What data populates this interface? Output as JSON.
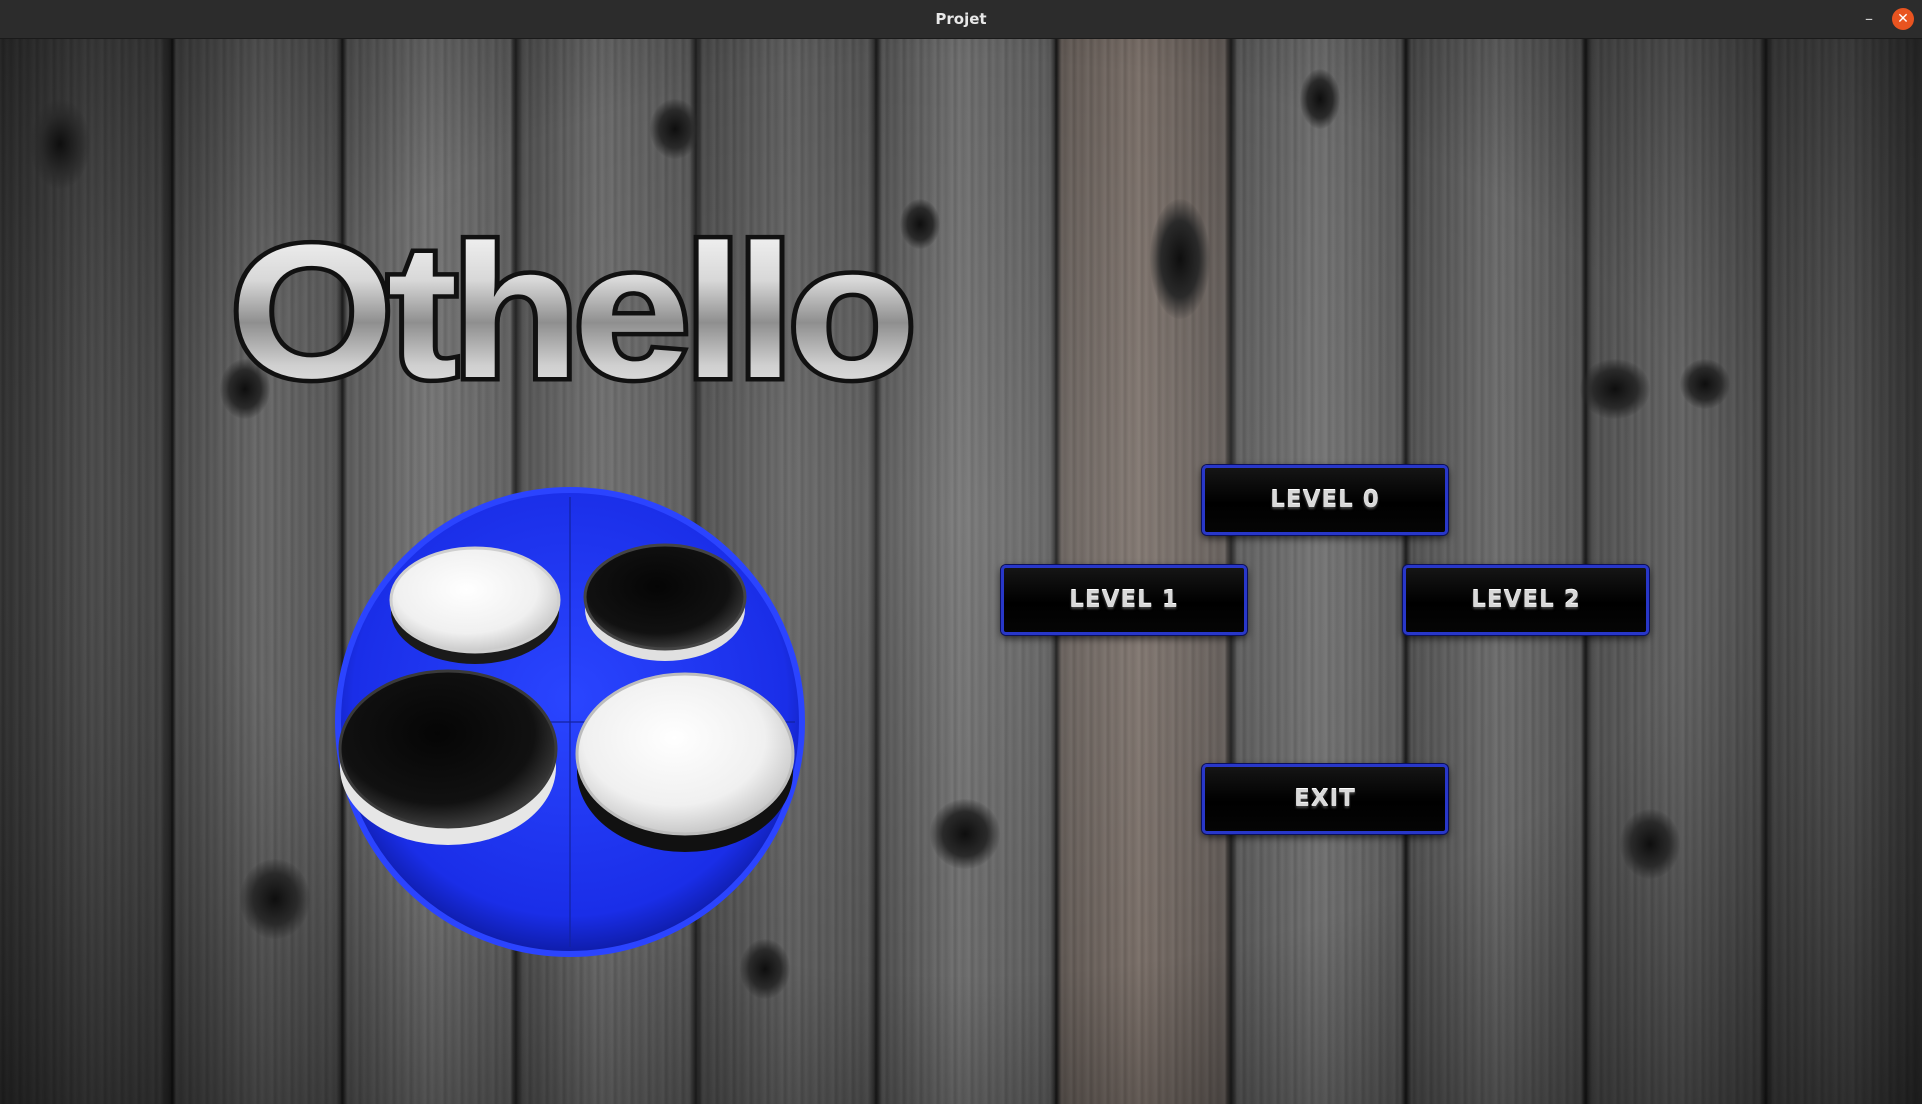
{
  "window": {
    "title": "Projet",
    "minimize_glyph": "–",
    "close_glyph": "✕",
    "close_color": "#e95420"
  },
  "game": {
    "logo_text": "Othello",
    "emblem": "othello-discs-emblem",
    "emblem_color": "#1a2ee8"
  },
  "menu": {
    "level0_label": "LEVEL 0",
    "level1_label": "LEVEL 1",
    "level2_label": "LEVEL 2",
    "exit_label": "EXIT",
    "button_border_color": "#2837c9"
  }
}
